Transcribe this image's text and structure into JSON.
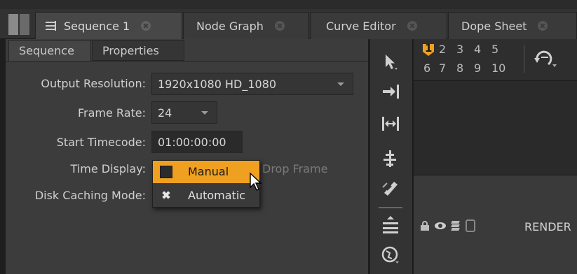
{
  "tabs": [
    {
      "label": "Sequence 1"
    },
    {
      "label": "Node Graph"
    },
    {
      "label": "Curve Editor"
    },
    {
      "label": "Dope Sheet"
    }
  ],
  "subtabs": {
    "sequence": "Sequence",
    "properties": "Properties"
  },
  "form": {
    "output_resolution": {
      "label": "Output Resolution:",
      "value": "1920x1080 HD_1080"
    },
    "frame_rate": {
      "label": "Frame Rate:",
      "value": "24"
    },
    "start_timecode": {
      "label": "Start Timecode:",
      "value": "01:00:00:00"
    },
    "time_display": {
      "label": "Time Display:",
      "drop_frame": "Drop Frame"
    },
    "disk_caching": {
      "label": "Disk Caching Mode:"
    }
  },
  "popup": {
    "options": [
      {
        "label": "Manual",
        "selected": true
      },
      {
        "label": "Automatic",
        "selected": false
      }
    ]
  },
  "viewer_numbers": {
    "row1": [
      "1",
      "2",
      "3",
      "4",
      "5"
    ],
    "row2": [
      "6",
      "7",
      "8",
      "9",
      "10"
    ]
  },
  "track": {
    "label": "RENDER"
  },
  "colors": {
    "accent": "#f0a020",
    "panel": "#3c3c3c"
  },
  "icons": [
    "select-arrow-icon",
    "move-icon",
    "expand-icon",
    "align-icon",
    "razor-icon",
    "slip-icon",
    "globe-icon",
    "refresh-icon",
    "lock-icon",
    "eye-icon",
    "layers-icon",
    "disk-icon"
  ]
}
